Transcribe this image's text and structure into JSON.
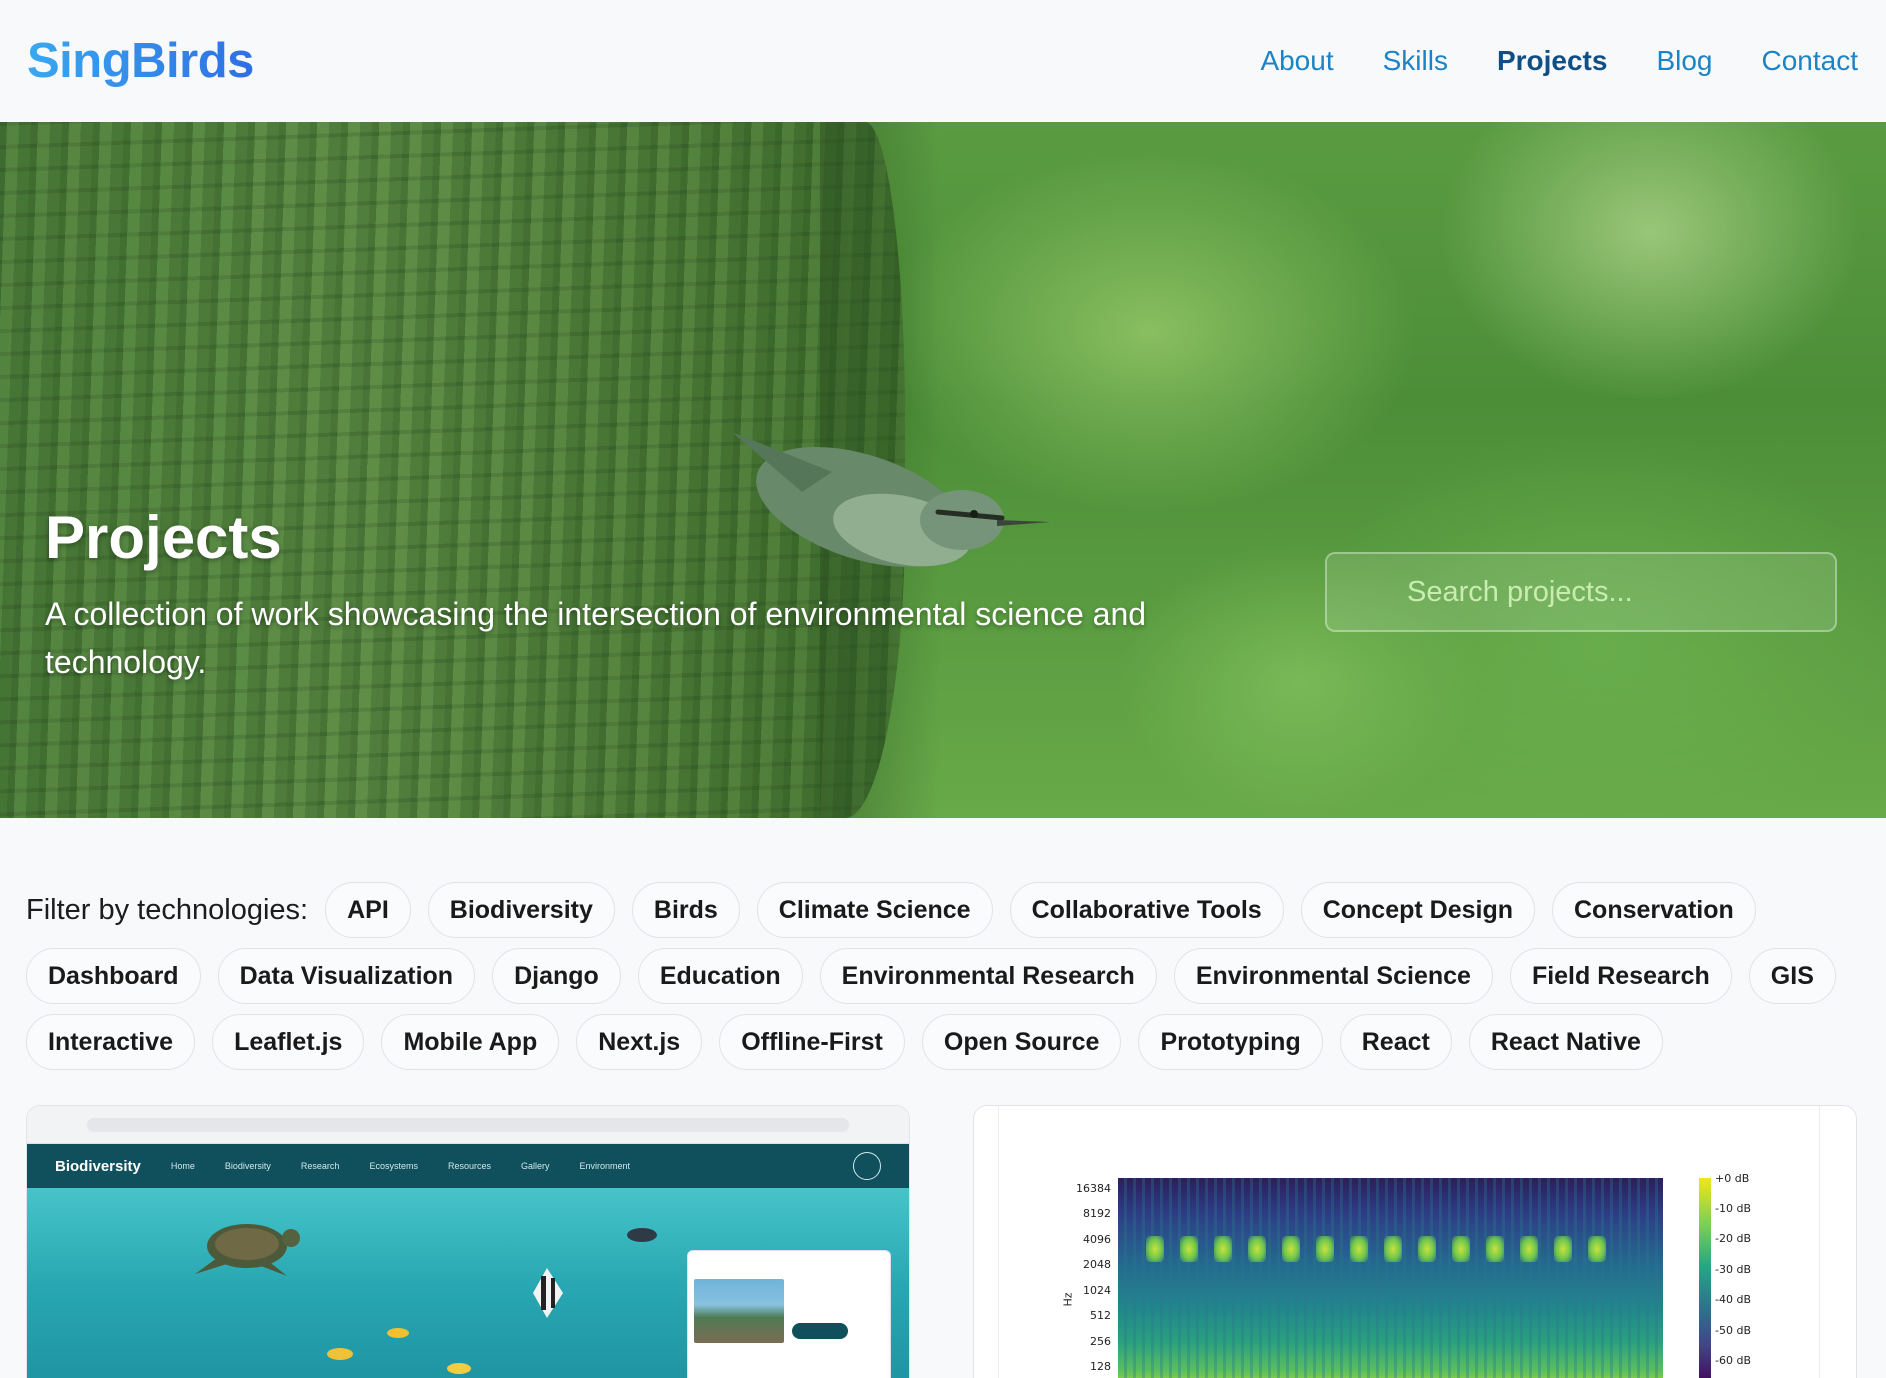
{
  "header": {
    "logo": "SingBirds",
    "nav": [
      {
        "label": "About",
        "active": false
      },
      {
        "label": "Skills",
        "active": false
      },
      {
        "label": "Projects",
        "active": true
      },
      {
        "label": "Blog",
        "active": false
      },
      {
        "label": "Contact",
        "active": false
      }
    ]
  },
  "hero": {
    "title": "Projects",
    "subtitle": "A collection of work showcasing the intersection of environmental science and technology.",
    "search_placeholder": "Search projects..."
  },
  "filters": {
    "label": "Filter by technologies:",
    "rows": [
      [
        "API",
        "Biodiversity",
        "Birds",
        "Climate Science",
        "Collaborative Tools",
        "Concept Design",
        "Conservation"
      ],
      [
        "Dashboard",
        "Data Visualization",
        "Django",
        "Education",
        "Environmental Research",
        "Environmental Science",
        "Field Research",
        "GIS"
      ],
      [
        "Interactive",
        "Leaflet.js",
        "Mobile App",
        "Next.js",
        "Offline-First",
        "Open Source",
        "Prototyping",
        "React",
        "React Native"
      ]
    ]
  },
  "cards": {
    "left": {
      "mini_logo": "Biodiversity",
      "mini_nav": [
        "Home",
        "Biodiversity",
        "Research",
        "Ecosystems",
        "Resources",
        "Gallery",
        "Environment"
      ]
    },
    "right": {
      "y_label": "Hz",
      "y_ticks": [
        "16384",
        "8192",
        "4096",
        "2048",
        "1024",
        "512",
        "256",
        "128"
      ],
      "colorbar_ticks": [
        "+0 dB",
        "-10 dB",
        "-20 dB",
        "-30 dB",
        "-40 dB",
        "-50 dB",
        "-60 dB"
      ]
    }
  },
  "colors": {
    "nav_link": "#1b84c6",
    "nav_active": "#0f4f86",
    "logo_start": "#38a8f0",
    "logo_end": "#2f6fe4"
  }
}
